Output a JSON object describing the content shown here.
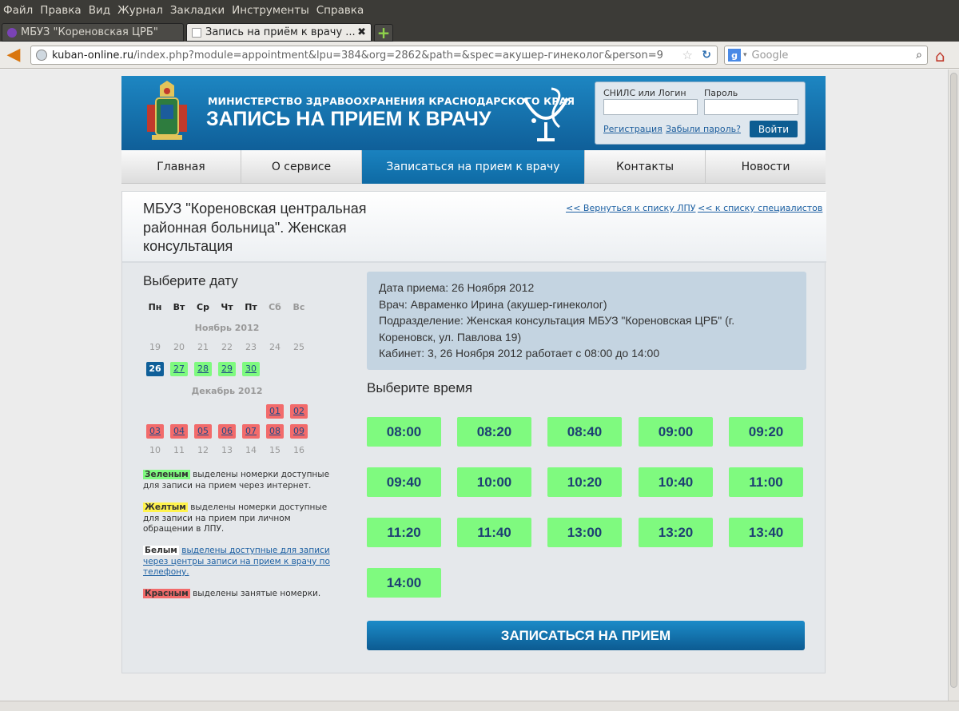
{
  "browser": {
    "menu": [
      "Файл",
      "Правка",
      "Вид",
      "Журнал",
      "Закладки",
      "Инструменты",
      "Справка"
    ],
    "tabs": [
      {
        "label": "МБУЗ \"Кореновская ЦРБ\""
      },
      {
        "label": "Запись на приём к врачу ..."
      }
    ],
    "url_domain": "kuban-online.ru",
    "url_path": "/index.php?module=appointment&lpu=384&org=2862&path=&spec=акушер-гинеколог&person=9",
    "search_placeholder": "Google"
  },
  "header": {
    "ministry": "МИНИСТЕРСТВО ЗДРАВООХРАНЕНИЯ КРАСНОДАРСКОГО КРАЯ",
    "title": "ЗАПИСЬ НА ПРИЕМ К ВРАЧУ",
    "login": {
      "login_label": "СНИЛС или Логин",
      "password_label": "Пароль",
      "register": "Регистрация",
      "forgot": "Забыли пароль?",
      "submit": "Войти"
    }
  },
  "nav": [
    "Главная",
    "О сервисе",
    "Записаться на прием к врачу",
    "Контакты",
    "Новости"
  ],
  "org": {
    "name": "МБУЗ \"Кореновская центральная районная больница\". Женская консультация",
    "back_lpu": "<< Вернуться к списку ЛПУ",
    "back_spec": "<< к списку специалистов"
  },
  "calendar": {
    "title": "Выберите дату",
    "dow": [
      "Пн",
      "Вт",
      "Ср",
      "Чт",
      "Пт",
      "Сб",
      "Вс"
    ],
    "month1": "Ноябрь 2012",
    "month2": "Декабрь 2012",
    "nov_row1": [
      "19",
      "20",
      "21",
      "22",
      "23",
      "24",
      "25"
    ],
    "nov_row2": [
      "26",
      "27",
      "28",
      "29",
      "30"
    ],
    "dec_row1": [
      "01",
      "02"
    ],
    "dec_row2": [
      "03",
      "04",
      "05",
      "06",
      "07",
      "08",
      "09"
    ],
    "dec_row3": [
      "10",
      "11",
      "12",
      "13",
      "14",
      "15",
      "16"
    ]
  },
  "legend": {
    "green_tag": "Зеленым",
    "green_text": "выделены номерки доступные для записи на прием через интернет.",
    "yellow_tag": "Желтым",
    "yellow_text": "выделены номерки доступные для записи на прием при личном обращении в ЛПУ.",
    "white_tag": "Белым",
    "white_text": "выделены доступные для записи через центры записи на прием к врачу по телефону.",
    "red_tag": "Красным",
    "red_text": "выделены занятые номерки."
  },
  "info": {
    "date": "Дата приема: 26 Ноября 2012",
    "doctor": "Врач: Авраменко Ирина (акушер-гинеколог)",
    "dept_line1": "Подразделение: Женская консультация МБУЗ \"Кореновская ЦРБ\" (г.",
    "dept_line2": "Кореновск, ул. Павлова 19)",
    "room": "Кабинет: 3, 26 Ноября 2012 работает с 08:00 до 14:00"
  },
  "times_title": "Выберите время",
  "times": [
    "08:00",
    "08:20",
    "08:40",
    "09:00",
    "09:20",
    "09:40",
    "10:00",
    "10:20",
    "10:40",
    "11:00",
    "11:20",
    "11:40",
    "13:00",
    "13:20",
    "13:40",
    "14:00"
  ],
  "submit": "ЗАПИСАТЬСЯ НА ПРИЕМ",
  "colors": {
    "slot_free": "#7ffa7f",
    "slot_busy": "#f26b6b",
    "brand": "#0f5f99"
  }
}
